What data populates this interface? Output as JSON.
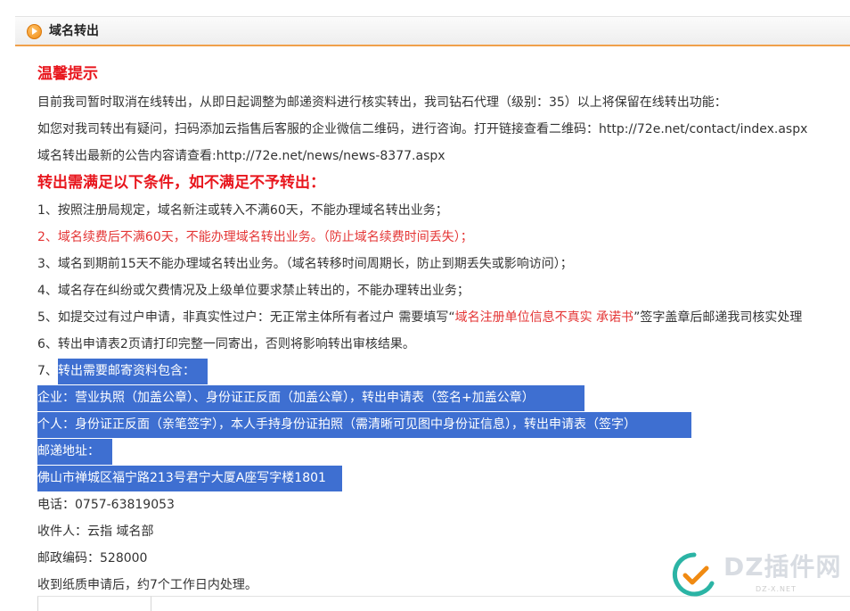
{
  "header": {
    "title": "域名转出",
    "icon": "play-circle-icon",
    "icon_color": "#f08a12"
  },
  "notice": {
    "heading": "温馨提示",
    "lines": [
      "目前我司暂时取消在线转出，从即日起调整为邮递资料进行核实转出，我司钻石代理（级别：35）以上将保留在线转出功能：",
      "如您对我司转出有疑问，扫码添加云指售后客服的企业微信二维码，进行咨询。打开链接查看二维码：http://72e.net/contact/index.aspx",
      "域名转出最新的公告内容请查看:http://72e.net/news/news-8377.aspx"
    ]
  },
  "conditions": {
    "heading": "转出需满足以下条件，如不满足不予转出：",
    "item1": "1、按照注册局规定，域名新注或转入不满60天，不能办理域名转出业务；",
    "item2": "2、域名续费后不满60天，不能办理域名转出业务。（防止域名续费时间丢失）；",
    "item3": "3、域名到期前15天不能办理域名转出业务。（域名转移时间周期长，防止到期丢失或影响访问）；",
    "item4": "4、域名存在纠纷或欠费情况及上级单位要求禁止转出的，不能办理转出业务；",
    "item5_prefix": "5、如提交过有过户申请，非真实性过户：无正常主体所有者过户 需要填写“",
    "item5_red": "域名注册单位信息不真实 承诺书",
    "item5_suffix": "”签字盖章后邮递我司核实处理",
    "item6": "6、转出申请表2页请打印完整一同寄出，否则将影响转出审核结果。",
    "item7_num": "7、",
    "item7": "转出需要邮寄资料包含：",
    "enterprise": "企业：营业执照（加盖公章）、身份证正反面（加盖公章），转出申请表（签名+加盖公章）",
    "personal": "个人：身份证正反面（亲笔签字），本人手持身份证拍照（需清晰可见图中身份证信息），转出申请表（签字）",
    "address_label": "邮递地址：",
    "address": "佛山市禅城区福宁路213号君宁大厦A座写字楼1801",
    "phone": "电话：0757-63819053",
    "recipient": "收件人：云指 域名部",
    "postcode": "邮政编码：528000",
    "processing": "收到纸质申请后，约7个工作日内处理。"
  },
  "colors": {
    "heading_red": "#e8161d",
    "warning_red": "#e43535",
    "selection_blue": "#3e6fd1"
  },
  "watermark": {
    "brand": "DZ插件网",
    "url": "DZ-X.NET"
  }
}
